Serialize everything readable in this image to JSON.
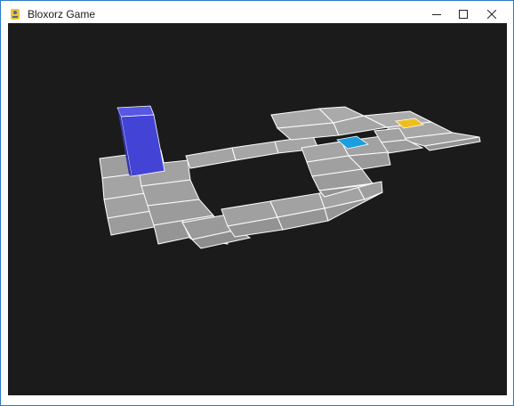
{
  "window": {
    "title": "Bloxorz Game",
    "icon": "pygame-snake-icon",
    "controls": {
      "minimize_icon": "minimize-icon",
      "maximize_icon": "maximize-icon",
      "close_icon": "close-icon"
    }
  },
  "game": {
    "background_color": "#1b1b1b",
    "tile_color": "#a0a0a0",
    "tile_edge_color": "#ffffff",
    "block_color": "#4343d6",
    "goal_color": "#f0be1c",
    "switch_color": "#1a9ee0"
  }
}
